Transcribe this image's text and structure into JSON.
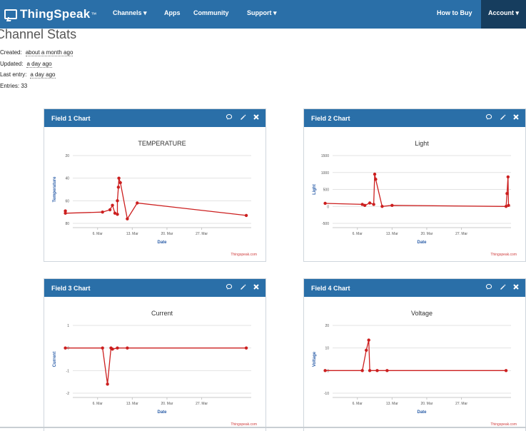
{
  "nav": {
    "brand": "ThingSpeak",
    "trademark": "™",
    "items": [
      "Channels ▾",
      "Apps",
      "Community",
      "Support ▾"
    ],
    "how_to_buy": "How to Buy",
    "account": "Account ▾"
  },
  "stats": {
    "title": "Channel Stats",
    "created_label": "Created:",
    "created_value": "about a month ago",
    "updated_label": "Updated:",
    "updated_value": "a day ago",
    "last_entry_label": "Last entry:",
    "last_entry_value": "a day ago",
    "entries": "Entries: 33"
  },
  "panels": [
    {
      "header": "Field 1 Chart",
      "title": "TEMPERATURE",
      "xlabel": "Date",
      "ylabel": "Temperature",
      "credit": "Thingspeak.com"
    },
    {
      "header": "Field 2 Chart",
      "title": "Light",
      "xlabel": "Date",
      "ylabel": "Light",
      "credit": "Thingspeak.com"
    },
    {
      "header": "Field 3 Chart",
      "title": "Current",
      "xlabel": "Date",
      "ylabel": "Current",
      "credit": "Thingspeak.com"
    },
    {
      "header": "Field 4 Chart",
      "title": "Voltage",
      "xlabel": "Date",
      "ylabel": "Voltage",
      "credit": "Thingspeak.com"
    }
  ],
  "colors": {
    "accent": "#2a6fa8",
    "series": "#cc1f1f",
    "nav_dark": "#163d5e"
  },
  "icons": [
    "comment-icon",
    "pencil-icon",
    "close-icon"
  ],
  "chart_data": [
    {
      "type": "line",
      "title": "TEMPERATURE",
      "xlabel": "Date",
      "ylabel": "Temperature",
      "x_ticks": [
        "6. Mar",
        "13. Mar",
        "20. Mar",
        "27. Mar"
      ],
      "x_range": [
        0,
        36
      ],
      "y_ticks": [
        "20",
        "40",
        "60",
        "80"
      ],
      "ylim": [
        20,
        80
      ],
      "series": [
        {
          "points": [
            [
              -1.5,
              31
            ],
            [
              -1.5,
              29
            ],
            [
              6,
              30
            ],
            [
              7.5,
              32
            ],
            [
              8,
              36
            ],
            [
              8.5,
              29
            ],
            [
              9,
              28
            ],
            [
              9,
              40
            ],
            [
              9.2,
              52
            ],
            [
              9.3,
              60
            ],
            [
              9.6,
              56
            ],
            [
              11,
              24
            ],
            [
              13,
              38
            ],
            [
              35,
              27
            ]
          ]
        }
      ]
    },
    {
      "type": "line",
      "title": "Light",
      "xlabel": "Date",
      "ylabel": "Light",
      "x_ticks": [
        "6. Mar",
        "13. Mar",
        "20. Mar",
        "27. Mar"
      ],
      "x_range": [
        0,
        36
      ],
      "y_ticks": [
        "1500",
        "1000",
        "500",
        "0",
        "-500"
      ],
      "ylim": [
        -500,
        1500
      ],
      "series": [
        {
          "points": [
            [
              -1.5,
              90
            ],
            [
              6,
              60
            ],
            [
              6.5,
              30
            ],
            [
              7.5,
              100
            ],
            [
              8.3,
              60
            ],
            [
              8.5,
              950
            ],
            [
              8.7,
              800
            ],
            [
              10,
              0
            ],
            [
              12,
              30
            ],
            [
              35,
              0
            ],
            [
              35.2,
              380
            ],
            [
              35.4,
              870
            ],
            [
              35.5,
              30
            ]
          ]
        }
      ]
    },
    {
      "type": "line",
      "title": "Current",
      "xlabel": "Date",
      "ylabel": "Current",
      "x_ticks": [
        "6. Mar",
        "13. Mar",
        "20. Mar",
        "27. Mar"
      ],
      "x_range": [
        0,
        36
      ],
      "y_ticks": [
        "1",
        "0",
        "-1",
        "-2"
      ],
      "ylim": [
        -2,
        1
      ],
      "series": [
        {
          "points": [
            [
              -1.5,
              0
            ],
            [
              6,
              0
            ],
            [
              7,
              -1.6
            ],
            [
              7.7,
              0
            ],
            [
              8,
              -0.05
            ],
            [
              9,
              0
            ],
            [
              11,
              0
            ],
            [
              35,
              0
            ]
          ]
        }
      ]
    },
    {
      "type": "line",
      "title": "Voltage",
      "xlabel": "Date",
      "ylabel": "Voltage",
      "x_ticks": [
        "6. Mar",
        "13. Mar",
        "20. Mar",
        "27. Mar"
      ],
      "x_range": [
        0,
        36
      ],
      "y_ticks": [
        "20",
        "10",
        "0",
        "-10"
      ],
      "ylim": [
        -10,
        20
      ],
      "series": [
        {
          "points": [
            [
              -1.5,
              0
            ],
            [
              6,
              0
            ],
            [
              6.8,
              9
            ],
            [
              7.3,
              13.5
            ],
            [
              7.5,
              0
            ],
            [
              9,
              0
            ],
            [
              11,
              0
            ],
            [
              35,
              0
            ]
          ]
        }
      ]
    }
  ]
}
